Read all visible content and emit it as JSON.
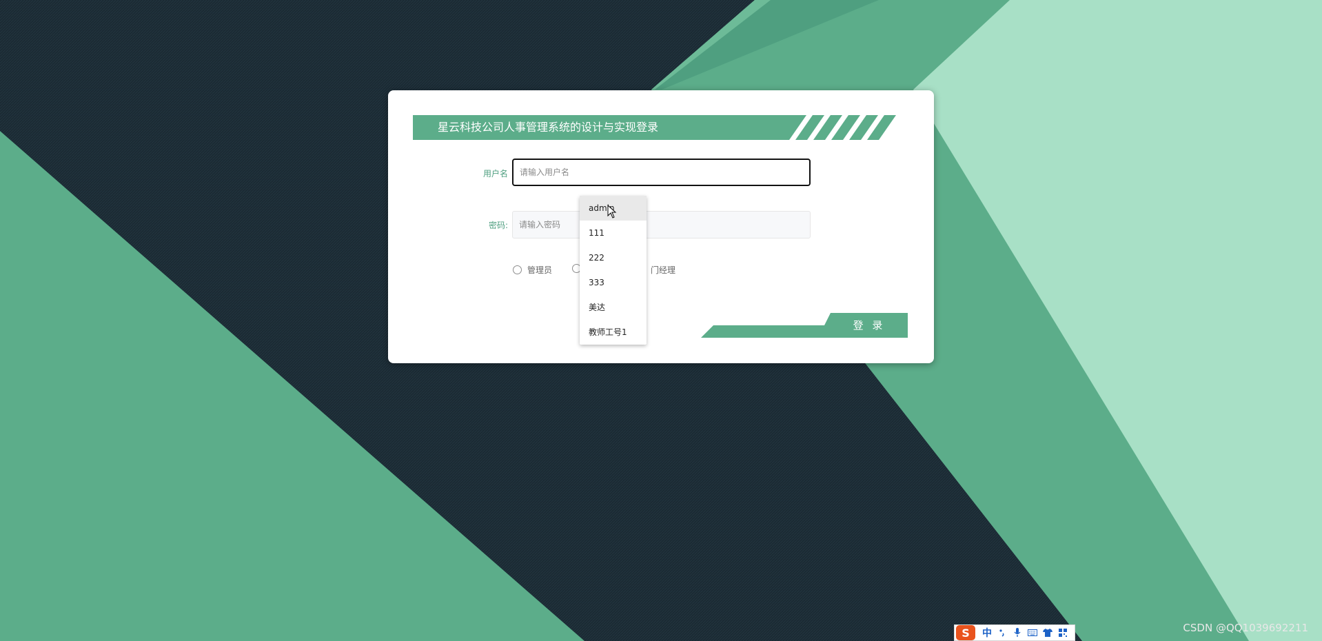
{
  "colors": {
    "accent": "#5cad8a",
    "dark_background": "#1b2a33",
    "light_panel": "#a8e0c6"
  },
  "login": {
    "title": "星云科技公司人事管理系统的设计与实现登录",
    "username_label": "用户名",
    "username_placeholder": "请输入用户名",
    "password_label": "密码:",
    "password_placeholder": "请输入密码",
    "roles": [
      "管理员",
      "",
      "门经理"
    ],
    "login_button": "登 录"
  },
  "autocomplete": {
    "items": [
      "admin",
      "111",
      "222",
      "333",
      "美达",
      "教师工号1"
    ],
    "hovered_index": 0
  },
  "taskbar": {
    "ime_icons": [
      "sogou-logo-icon",
      "chinese-mode-icon",
      "punctuation-icon",
      "microphone-icon",
      "keyboard-icon",
      "skin-icon",
      "grid-menu-icon"
    ],
    "ime_logo_text": "S",
    "ime_mode_text": "中"
  },
  "watermark": "CSDN @QQ1039692211"
}
